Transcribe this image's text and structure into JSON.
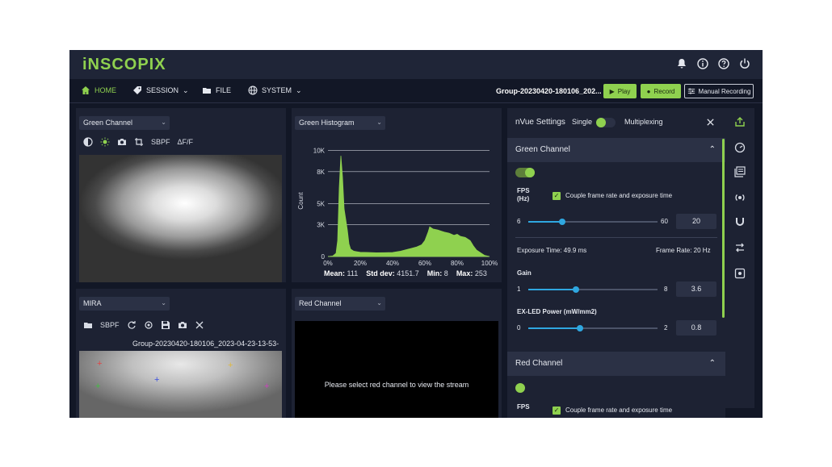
{
  "app": {
    "logo": "iNSCOPIX"
  },
  "header": {
    "icons": [
      "bell-icon",
      "info-icon",
      "help-icon",
      "power-icon"
    ]
  },
  "nav": {
    "home": "HOME",
    "session": "SESSION",
    "file": "FILE",
    "system": "SYSTEM"
  },
  "toolbar": {
    "group_name": "Group-20230420-180106_202...",
    "play_label": "Play",
    "record_label": "Record",
    "manual_label": "Manual Recording"
  },
  "green_panel": {
    "channel_select": "Green Channel",
    "tools": [
      "contrast-icon",
      "brightness-icon",
      "camera-icon",
      "crop-icon"
    ],
    "sbpf_label": "SBPF",
    "dff_label": "ΔF/F"
  },
  "mira_panel": {
    "select": "MIRA",
    "sbpf_label": "SBPF",
    "filename": "Group-20230420-180106_2023-04-23-13-53-"
  },
  "histogram": {
    "select": "Green Histogram",
    "stats": {
      "mean_label": "Mean:",
      "mean_value": "111",
      "std_label": "Std dev:",
      "std_value": "4151.7",
      "min_label": "Min:",
      "min_value": "8",
      "max_label": "Max:",
      "max_value": "253"
    }
  },
  "red_panel": {
    "select": "Red Channel",
    "message": "Please select red channel to view the stream"
  },
  "settings": {
    "title": "nVue Settings",
    "mode_single": "Single",
    "mode_multiplexing": "Multiplexing",
    "green_section": {
      "title": "Green Channel",
      "fps_label_1": "FPS",
      "fps_label_2": "(Hz)",
      "couple_label": "Couple frame rate and exposure time",
      "fps_min": "6",
      "fps_max": "60",
      "fps_value": "20",
      "fps_fraction": 0.26,
      "exposure_text": "Exposure Time: 49.9 ms",
      "frame_rate_text": "Frame Rate: 20 Hz",
      "gain_label": "Gain",
      "gain_min": "1",
      "gain_max": "8",
      "gain_value": "3.6",
      "gain_fraction": 0.37,
      "led_label": "EX-LED Power (mW/mm2)",
      "led_min": "0",
      "led_max": "2",
      "led_value": "0.8",
      "led_fraction": 0.4
    },
    "red_section": {
      "title": "Red Channel",
      "fps_label": "FPS",
      "couple_label": "Couple frame rate and exposure time"
    }
  },
  "right_sidebar": {
    "icons": [
      "export-icon",
      "speedometer-icon",
      "layers-icon",
      "broadcast-icon",
      "magnet-icon",
      "swap-icon",
      "focus-icon"
    ]
  },
  "chart_data": {
    "type": "area",
    "title": "",
    "xlabel": "",
    "ylabel": "Count",
    "x_unit": "%",
    "x_ticks": [
      "0%",
      "20%",
      "40%",
      "60%",
      "80%",
      "100%"
    ],
    "y_ticks": [
      "0",
      "3K",
      "5K",
      "8K",
      "10K"
    ],
    "ylim": [
      0,
      10500
    ],
    "grid": true,
    "series": [
      {
        "color": "#8fd14f",
        "x": [
          0,
          3,
          5,
          6,
          7,
          8,
          9,
          10,
          11,
          12,
          13,
          14,
          16,
          18,
          20,
          25,
          30,
          35,
          40,
          45,
          50,
          55,
          58,
          60,
          62,
          63,
          65,
          68,
          70,
          72,
          75,
          78,
          80,
          82,
          85,
          88,
          90,
          92,
          95,
          97,
          100
        ],
        "y": [
          0,
          50,
          300,
          1500,
          6500,
          9500,
          7500,
          4500,
          3500,
          2500,
          1200,
          700,
          500,
          450,
          400,
          380,
          350,
          360,
          380,
          500,
          700,
          900,
          1100,
          1500,
          2300,
          2800,
          2600,
          2500,
          2400,
          2300,
          2200,
          2000,
          2100,
          1900,
          1800,
          1500,
          1000,
          600,
          300,
          100,
          0
        ]
      }
    ]
  }
}
